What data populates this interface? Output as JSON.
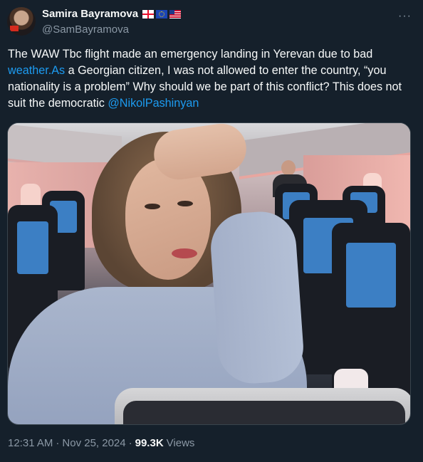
{
  "author": {
    "display_name": "Samira Bayramova",
    "handle": "@SamBayramova",
    "flags": [
      "georgia-flag-icon",
      "eu-flag-icon",
      "us-flag-icon"
    ]
  },
  "tweet": {
    "segments": [
      {
        "text": "The WAW Tbc flight made an emergency landing in Yerevan due to bad ",
        "link": false
      },
      {
        "text": "weather.As",
        "link": true
      },
      {
        "text": " a Georgian citizen, I was not allowed to enter the country, “you nationality is a problem” Why should we be part of this conflict? This does not suit the democratic ",
        "link": false
      },
      {
        "text": "@NikolPashinyan",
        "link": true
      }
    ]
  },
  "meta": {
    "time": "12:31 AM",
    "separator1": "·",
    "date": "Nov 25, 2024",
    "separator2": "·",
    "views_count": "99.3K",
    "views_label": "Views"
  },
  "more_menu": {
    "glyph": "···"
  },
  "colors": {
    "background": "#15202b",
    "text_primary": "#f7f9f9",
    "text_secondary": "#8b98a5",
    "link": "#1d9bf0"
  }
}
